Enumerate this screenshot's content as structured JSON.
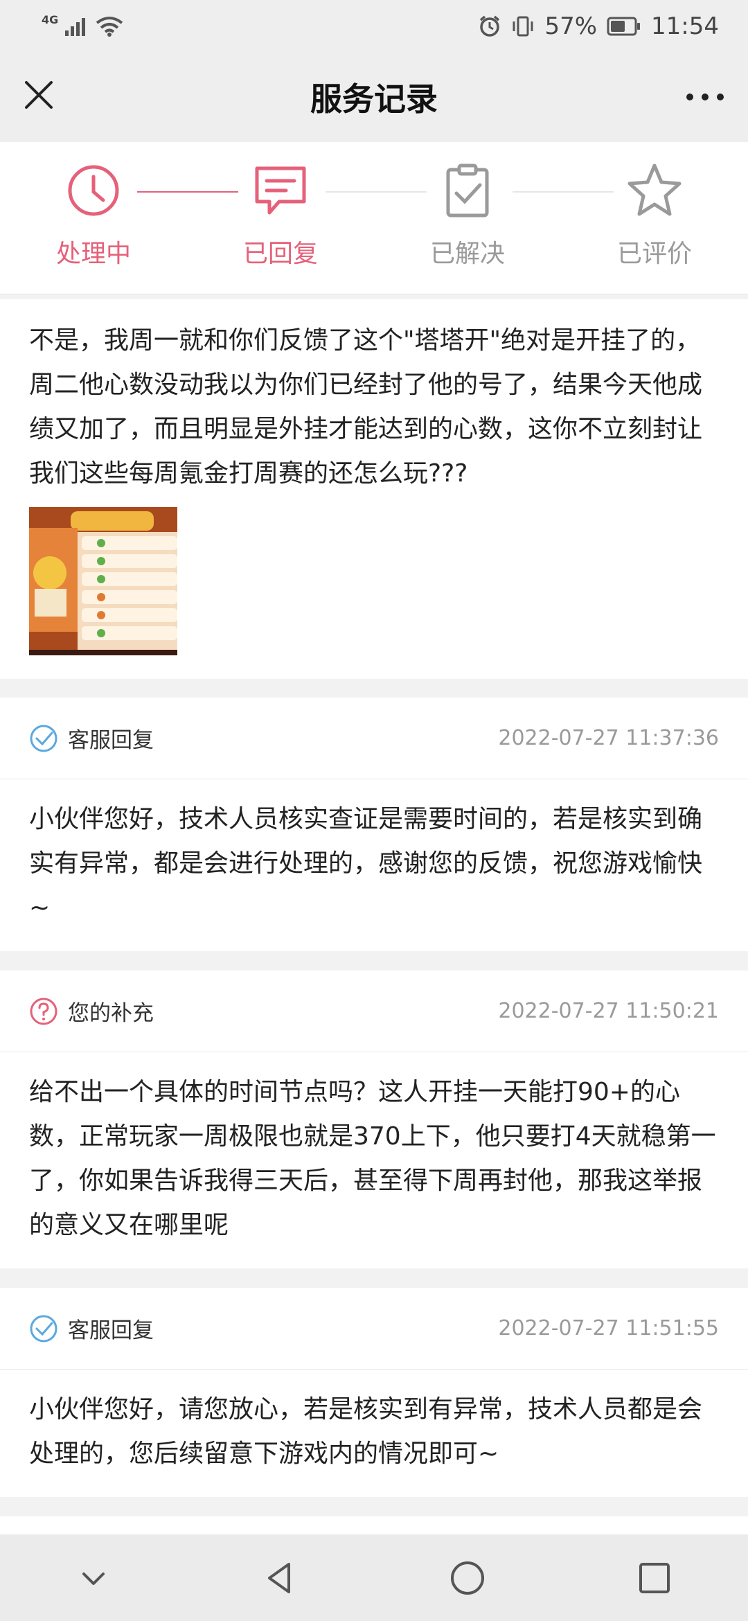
{
  "status_bar": {
    "network_type": "4G",
    "battery": "57%",
    "time": "11:54"
  },
  "header": {
    "title": "服务记录",
    "close_icon": "close-icon",
    "more_icon": "more-icon"
  },
  "steps": [
    {
      "label": "处理中",
      "icon": "clock-icon",
      "state": "active"
    },
    {
      "label": "已回复",
      "icon": "message-icon",
      "state": "active"
    },
    {
      "label": "已解决",
      "icon": "clipboard-check-icon",
      "state": "inactive"
    },
    {
      "label": "已评价",
      "icon": "star-icon",
      "state": "inactive"
    }
  ],
  "colors": {
    "accent": "#e5617a",
    "inactive": "#9a9a9a",
    "service_blue": "#5aa8e0"
  },
  "records": [
    {
      "type": "user",
      "text": "不是，我周一就和你们反馈了这个\"塔塔开\"绝对是开挂了的，周二他心数没动我以为你们已经封了他的号了，结果今天他成绩又加了，而且明显是外挂才能达到的心数，这你不立刻封让我们这些每周氪金打周赛的还怎么玩???",
      "has_image": true
    },
    {
      "type": "service",
      "label": "客服回复",
      "icon": "check-circle-icon",
      "time": "2022-07-27 11:37:36",
      "text": "小伙伴您好，技术人员核实查证是需要时间的，若是核实到确实有异常，都是会进行处理的，感谢您的反馈，祝您游戏愉快~"
    },
    {
      "type": "user_followup",
      "label": "您的补充",
      "icon": "question-circle-icon",
      "time": "2022-07-27 11:50:21",
      "text": "给不出一个具体的时间节点吗？这人开挂一天能打90+的心数，正常玩家一周极限也就是370上下，他只要打4天就稳第一了，你如果告诉我得三天后，甚至得下周再封他，那我这举报的意义又在哪里呢"
    },
    {
      "type": "service",
      "label": "客服回复",
      "icon": "check-circle-icon",
      "time": "2022-07-27 11:51:55",
      "text": "小伙伴您好，请您放心，若是核实到有异常，技术人员都是会处理的，您后续留意下游戏内的情况即可~"
    }
  ],
  "nav_bar": {
    "back_icon": "nav-back-icon",
    "home_icon": "nav-home-icon",
    "recents_icon": "nav-recents-icon",
    "collapse_icon": "chevron-down-icon"
  }
}
